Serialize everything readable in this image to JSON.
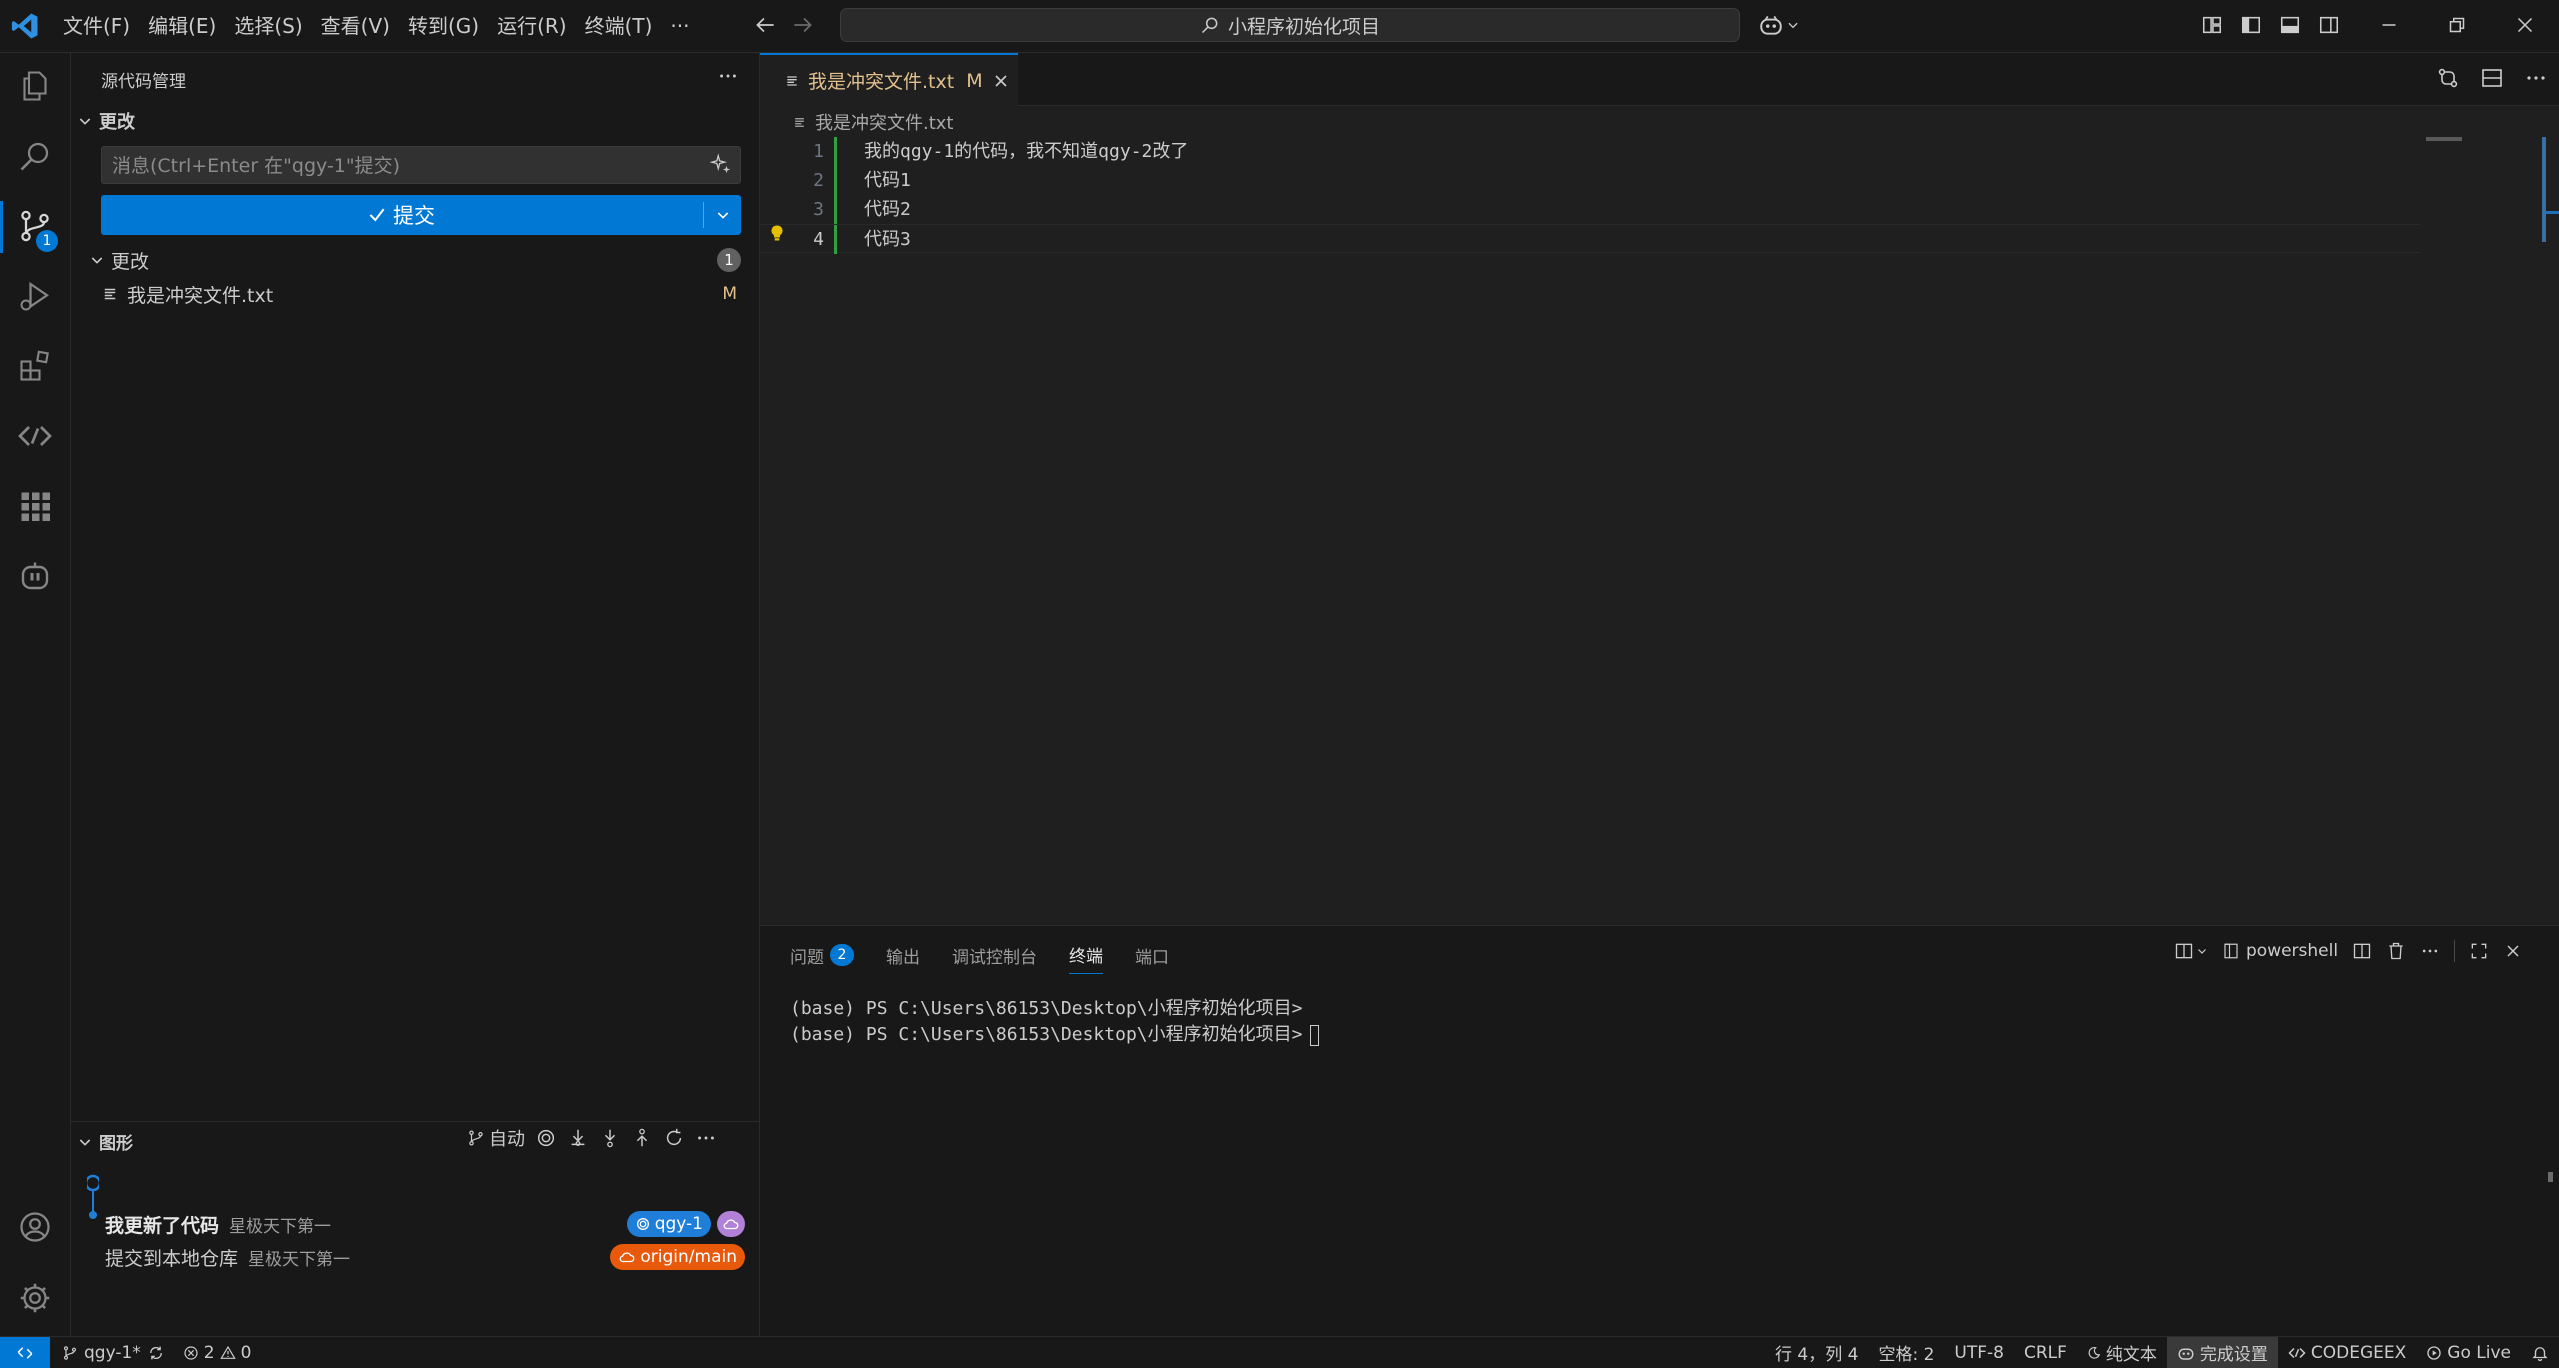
{
  "titlebar": {
    "menu": [
      "文件(F)",
      "编辑(E)",
      "选择(S)",
      "查看(V)",
      "转到(G)",
      "运行(R)",
      "终端(T)",
      "···"
    ],
    "search": "小程序初始化项目"
  },
  "activity": {
    "scm_badge": "1"
  },
  "sidebar": {
    "title": "源代码管理",
    "changes_section": "更改",
    "commit_placeholder": "消息(Ctrl+Enter 在\"qgy-1\"提交)",
    "commit_label": "提交",
    "changes_group": "更改",
    "changes_count": "1",
    "file_name": "我是冲突文件.txt",
    "file_status": "M",
    "graph": {
      "title": "图形",
      "auto_label": "自动",
      "commits": [
        {
          "message": "我更新了代码",
          "author": "星极天下第一",
          "ref": "qgy-1",
          "ref_color": "#1f7fd8"
        },
        {
          "message": "提交到本地仓库",
          "author": "星极天下第一",
          "ref": "origin/main",
          "ref_color": "#e8590c"
        }
      ]
    }
  },
  "editor": {
    "tab_title": "我是冲突文件.txt",
    "tab_status": "M",
    "breadcrumb": "我是冲突文件.txt",
    "lines": [
      {
        "num": "1",
        "text": "我的qgy-1的代码，我不知道qgy-2改了"
      },
      {
        "num": "2",
        "text": "代码1"
      },
      {
        "num": "3",
        "text": "代码2"
      },
      {
        "num": "4",
        "text": "代码3"
      }
    ]
  },
  "panel": {
    "tabs": [
      {
        "label": "问题",
        "badge": "2"
      },
      {
        "label": "输出"
      },
      {
        "label": "调试控制台"
      },
      {
        "label": "终端"
      },
      {
        "label": "端口"
      }
    ],
    "shell": "powershell",
    "terminal_lines": [
      "(base) PS C:\\Users\\86153\\Desktop\\小程序初始化项目>",
      "(base) PS C:\\Users\\86153\\Desktop\\小程序初始化项目>"
    ]
  },
  "statusbar": {
    "branch": "qgy-1*",
    "errors": "2",
    "warnings": "0",
    "position": "行 4，列 4",
    "spaces": "空格: 2",
    "encoding": "UTF-8",
    "eol": "CRLF",
    "language": "纯文本",
    "setup": "完成设置",
    "codegeex": "CODEGEEX",
    "golive": "Go Live"
  },
  "colors": {
    "accent": "#0078d4",
    "modified": "#e2c08d",
    "origin_badge": "#e8590c"
  }
}
